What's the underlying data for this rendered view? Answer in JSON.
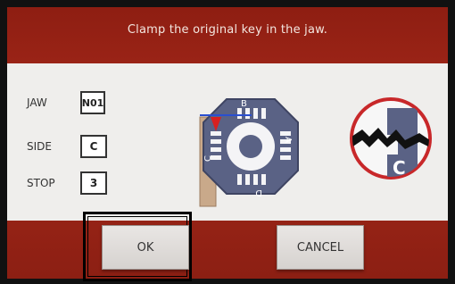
{
  "screen": {
    "title": "Clamp the original key in the jaw."
  },
  "fields": [
    {
      "label": "JAW",
      "value": "N01"
    },
    {
      "label": "SIDE",
      "value": "C"
    },
    {
      "label": "STOP",
      "value": "3"
    }
  ],
  "jaw_diagram": {
    "sides": [
      "B",
      "A",
      "D",
      "C"
    ]
  },
  "key_badge": {
    "letter": "C"
  },
  "buttons": {
    "ok": "OK",
    "cancel": "CANCEL"
  },
  "colors": {
    "accent_red": "#a5281a",
    "arrow_red": "#d72020",
    "panel": "#efeeec",
    "jaw_blue": "#5a6285"
  }
}
